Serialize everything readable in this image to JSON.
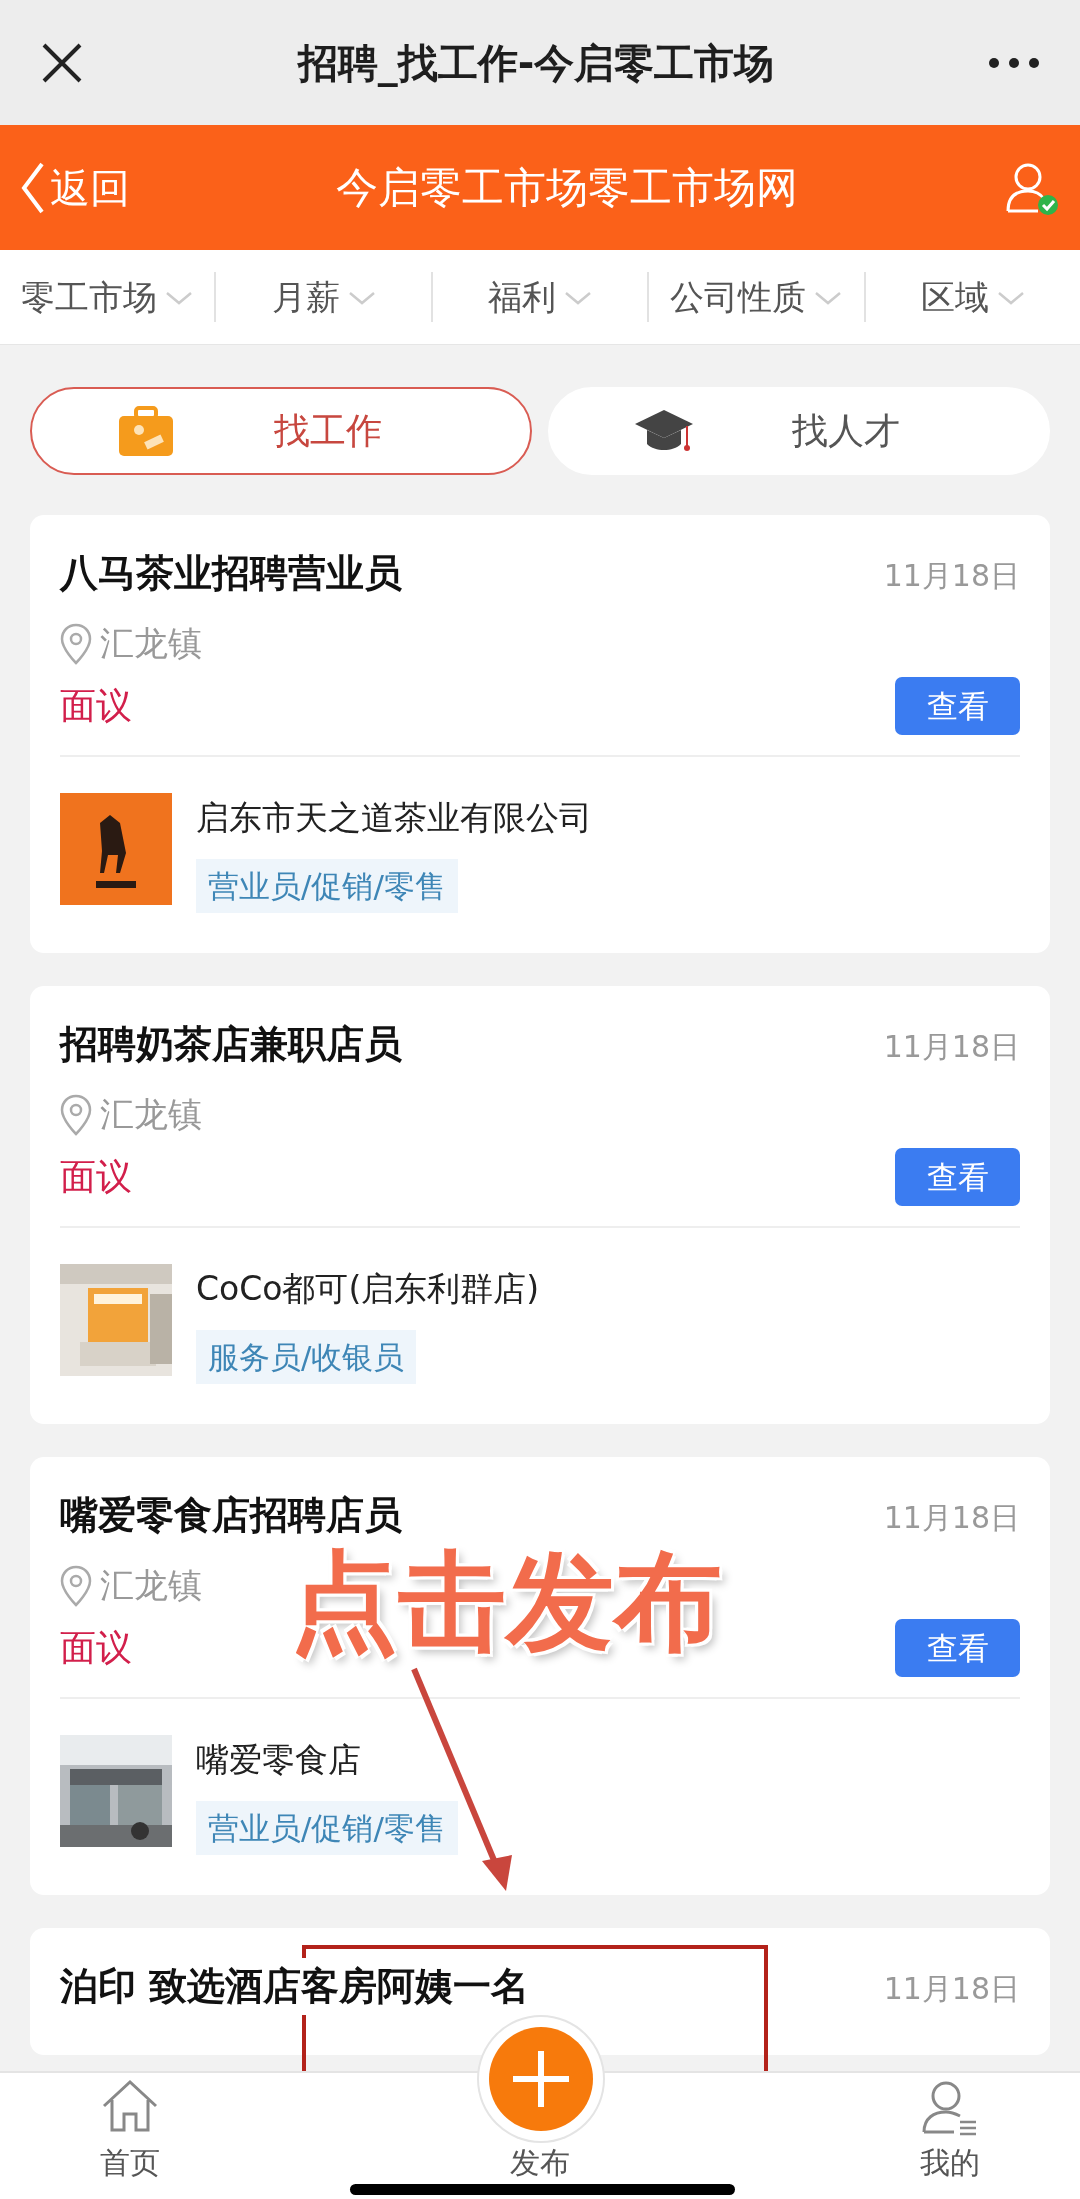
{
  "browser_bar": {
    "title": "招聘_找工作-今启零工市场"
  },
  "header": {
    "back": "返回",
    "title": "今启零工市场零工市场网"
  },
  "filters": [
    {
      "label": "零工市场"
    },
    {
      "label": "月薪"
    },
    {
      "label": "福利"
    },
    {
      "label": "公司性质"
    },
    {
      "label": "区域"
    }
  ],
  "mode_tabs": [
    {
      "label": "找工作",
      "selected": true,
      "kind": "briefcase"
    },
    {
      "label": "找人才",
      "selected": false,
      "kind": "cap"
    }
  ],
  "jobs": [
    {
      "title": "八马茶业招聘营业员",
      "date": "11月18日",
      "location": "汇龙镇",
      "salary": "面议",
      "action": "查看",
      "company": "启东市天之道茶业有限公司",
      "tag": "营业员/促销/零售"
    },
    {
      "title": "招聘奶茶店兼职店员",
      "date": "11月18日",
      "location": "汇龙镇",
      "salary": "面议",
      "action": "查看",
      "company": "CoCo都可(启东利群店)",
      "tag": "服务员/收银员"
    },
    {
      "title": "嘴爱零食店招聘店员",
      "date": "11月18日",
      "location": "汇龙镇",
      "salary": "面议",
      "action": "查看",
      "company": "嘴爱零食店",
      "tag": "营业员/促销/零售"
    },
    {
      "title": "泊印 致选酒店客房阿姨一名",
      "date": "11月18日"
    }
  ],
  "annotation": {
    "text": "点击发布"
  },
  "tab_bar": [
    {
      "label": "首页",
      "kind": "home"
    },
    {
      "label": "发布",
      "kind": "post"
    },
    {
      "label": "我的",
      "kind": "profile"
    }
  ]
}
